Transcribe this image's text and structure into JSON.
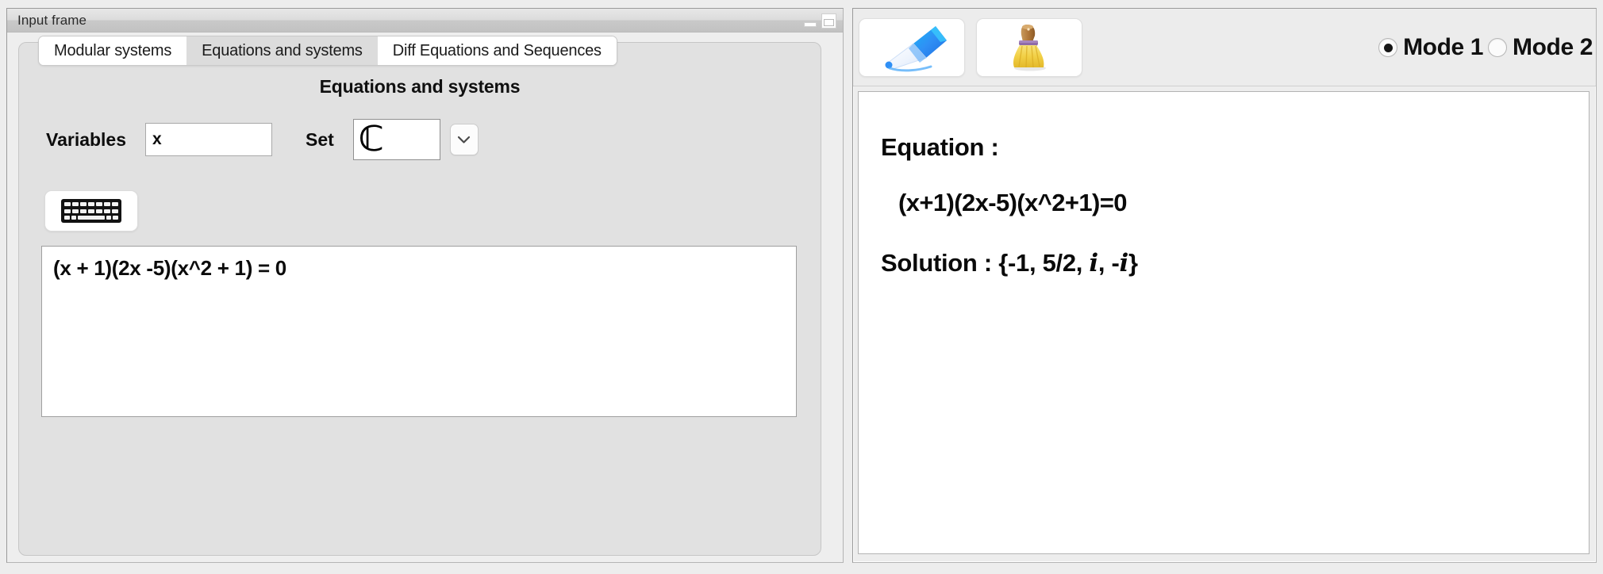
{
  "window": {
    "title": "Input frame",
    "minimize_icon": "minimize-icon",
    "restore_icon": "restore-icon"
  },
  "tabs": [
    {
      "label": "Modular systems",
      "selected": false
    },
    {
      "label": "Equations and systems",
      "selected": true
    },
    {
      "label": "Diff Equations and Sequences",
      "selected": false
    }
  ],
  "panel": {
    "heading": "Equations and systems",
    "variables_label": "Variables",
    "variables_value": "x",
    "set_label": "Set",
    "set_value": "ℂ",
    "dropdown_icon": "chevron-down-icon",
    "keyboard_icon": "keyboard-icon",
    "equation_input": "(x + 1)(2x -5)(x^2 + 1) = 0",
    "equation_placeholder": ""
  },
  "toolbar": {
    "compute_icon": "pen-icon",
    "clear_icon": "broom-icon",
    "modes": [
      {
        "label": "Mode 1",
        "selected": true
      },
      {
        "label": "Mode 2",
        "selected": false
      }
    ]
  },
  "output": {
    "equation_label": "Equation :",
    "equation_value": "(x+1)(2x-5)(x^2+1)=0",
    "solution_prefix": "Solution : {-1, 5/2, ",
    "solution_i1": "i",
    "solution_mid": ", -",
    "solution_i2": "i",
    "solution_suffix": "}"
  },
  "colors": {
    "window_bg": "#ededed",
    "panel_bg": "#e1e1e1",
    "field_bg": "#ffffff",
    "text": "#0a0a0a",
    "pen_blue": "#2f8ff5",
    "broom_yellow": "#f4d64a"
  }
}
